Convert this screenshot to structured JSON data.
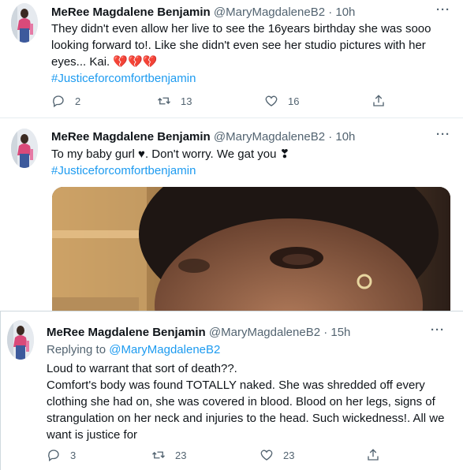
{
  "tweets": [
    {
      "name": "MeRee Magdalene Benjamin",
      "handle": "@MaryMagdaleneB2 · 10h",
      "text": "They didn't even allow her live to see the 16years birthday she was sooo looking forward to!. Like she didn't even see her studio pictures with her eyes... Kai. 💔💔💔",
      "hashtag": "#Justiceforcomfortbenjamin",
      "replies": "2",
      "retweets": "13",
      "likes": "16"
    },
    {
      "name": "MeRee Magdalene Benjamin",
      "handle": "@MaryMagdaleneB2 · 10h",
      "text": "To my baby gurl ♥. Don't worry. We gat you ❣",
      "hashtag": "#Justiceforcomfortbenjamin"
    },
    {
      "name": "MeRee Magdalene Benjamin",
      "handle": "@MaryMagdaleneB2 · 15h",
      "replying_label": "Replying to",
      "replying_to": "@MaryMagdaleneB2",
      "text_line1": "Loud to warrant that sort of death??.",
      "text_line2": "Comfort's body was found TOTALLY naked. She was shredded off every clothing she had on, she was covered in blood. Blood on her legs, signs of strangulation on her neck and injuries to the head. Such wickedness!. All we want is justice for",
      "replies": "3",
      "retweets": "23",
      "likes": "23"
    }
  ],
  "more_label": "···",
  "icons": [
    "reply-icon",
    "retweet-icon",
    "like-icon",
    "share-icon",
    "more-icon"
  ],
  "colors": {
    "link": "#1d9bf0",
    "secondary": "#536471",
    "text": "#0f1419",
    "heart": "#c8102e"
  }
}
